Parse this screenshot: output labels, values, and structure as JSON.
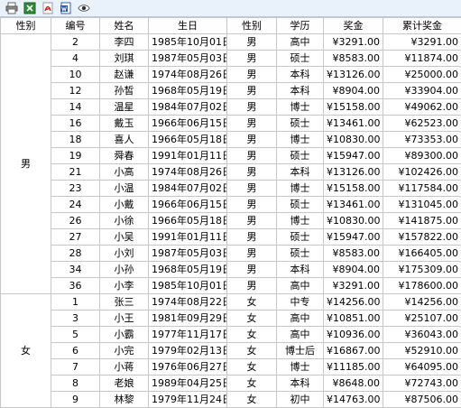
{
  "toolbar": {
    "icons": [
      "print-icon",
      "excel-icon",
      "pdf-icon",
      "word-icon",
      "preview-icon"
    ]
  },
  "columns": [
    "性别",
    "编号",
    "姓名",
    "生日",
    "性别",
    "学历",
    "奖金",
    "累计奖金"
  ],
  "groups": [
    {
      "label": "男",
      "rows": [
        [
          "2",
          "李四",
          "1985年10月01日",
          "男",
          "高中",
          "¥3291.00",
          "¥3291.00"
        ],
        [
          "4",
          "刘琪",
          "1987年05月03日",
          "男",
          "硕士",
          "¥8583.00",
          "¥11874.00"
        ],
        [
          "10",
          "赵谦",
          "1974年08月26日",
          "男",
          "本科",
          "¥13126.00",
          "¥25000.00"
        ],
        [
          "12",
          "孙皙",
          "1968年05月19日",
          "男",
          "本科",
          "¥8904.00",
          "¥33904.00"
        ],
        [
          "14",
          "温星",
          "1984年07月02日",
          "男",
          "博士",
          "¥15158.00",
          "¥49062.00"
        ],
        [
          "16",
          "戴玉",
          "1966年06月15日",
          "男",
          "硕士",
          "¥13461.00",
          "¥62523.00"
        ],
        [
          "18",
          "喜人",
          "1966年05月18日",
          "男",
          "博士",
          "¥10830.00",
          "¥73353.00"
        ],
        [
          "19",
          "舜春",
          "1991年01月11日",
          "男",
          "硕士",
          "¥15947.00",
          "¥89300.00"
        ],
        [
          "21",
          "小高",
          "1974年08月26日",
          "男",
          "本科",
          "¥13126.00",
          "¥102426.00"
        ],
        [
          "23",
          "小温",
          "1984年07月02日",
          "男",
          "博士",
          "¥15158.00",
          "¥117584.00"
        ],
        [
          "24",
          "小戴",
          "1966年06月15日",
          "男",
          "硕士",
          "¥13461.00",
          "¥131045.00"
        ],
        [
          "26",
          "小徐",
          "1966年05月18日",
          "男",
          "博士",
          "¥10830.00",
          "¥141875.00"
        ],
        [
          "27",
          "小吴",
          "1991年01月11日",
          "男",
          "硕士",
          "¥15947.00",
          "¥157822.00"
        ],
        [
          "28",
          "小刘",
          "1987年05月03日",
          "男",
          "硕士",
          "¥8583.00",
          "¥166405.00"
        ],
        [
          "34",
          "小孙",
          "1968年05月19日",
          "男",
          "本科",
          "¥8904.00",
          "¥175309.00"
        ],
        [
          "36",
          "小李",
          "1985年10月01日",
          "男",
          "高中",
          "¥3291.00",
          "¥178600.00"
        ]
      ]
    },
    {
      "label": "女",
      "rows": [
        [
          "1",
          "张三",
          "1974年08月22日",
          "女",
          "中专",
          "¥14256.00",
          "¥14256.00"
        ],
        [
          "3",
          "小王",
          "1981年09月29日",
          "女",
          "高中",
          "¥10851.00",
          "¥25107.00"
        ],
        [
          "5",
          "小霸",
          "1977年11月17日",
          "女",
          "高中",
          "¥10936.00",
          "¥36043.00"
        ],
        [
          "6",
          "小完",
          "1979年02月13日",
          "女",
          "博士后",
          "¥16867.00",
          "¥52910.00"
        ],
        [
          "7",
          "小蒋",
          "1976年06月27日",
          "女",
          "博士",
          "¥11185.00",
          "¥64095.00"
        ],
        [
          "8",
          "老娘",
          "1989年04月25日",
          "女",
          "本科",
          "¥8648.00",
          "¥72743.00"
        ],
        [
          "9",
          "林黎",
          "1979年11月24日",
          "女",
          "初中",
          "¥14763.00",
          "¥87506.00"
        ]
      ]
    }
  ]
}
